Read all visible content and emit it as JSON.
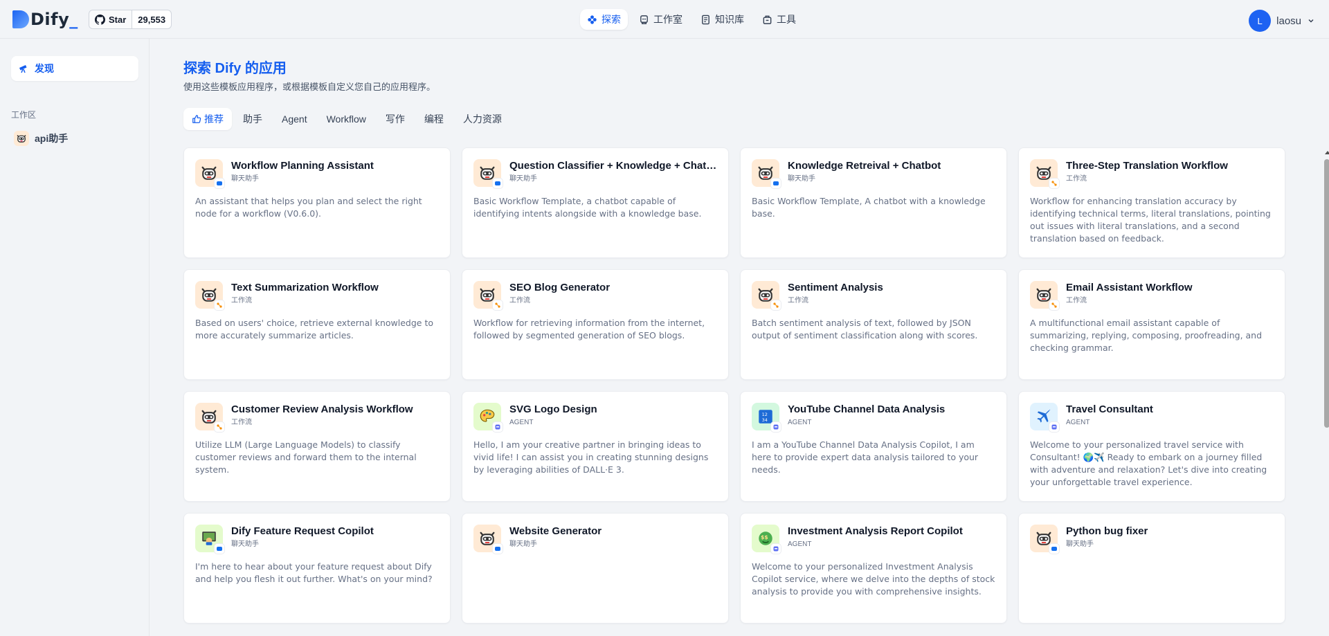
{
  "header": {
    "logo_text": "Dify",
    "logo_cursor": "_",
    "github": {
      "star_label": "Star",
      "count": "29,553"
    },
    "nav": [
      {
        "label": "探索",
        "icon": "explore-icon",
        "active": true
      },
      {
        "label": "工作室",
        "icon": "studio-icon",
        "active": false
      },
      {
        "label": "知识库",
        "icon": "knowledge-icon",
        "active": false
      },
      {
        "label": "工具",
        "icon": "tools-icon",
        "active": false
      }
    ],
    "user": {
      "initial": "L",
      "name": "laosu"
    }
  },
  "sidebar": {
    "discover_label": "发现",
    "workspace_title": "工作区",
    "apps": [
      {
        "name": "api助手",
        "icon": "robot-icon"
      }
    ]
  },
  "main": {
    "title": "探索 Dify 的应用",
    "subtitle": "使用这些模板应用程序，或根据模板自定义您自己的应用程序。",
    "categories": [
      {
        "label": "推荐",
        "active": true,
        "icon": "thumbs-up-icon"
      },
      {
        "label": "助手",
        "active": false
      },
      {
        "label": "Agent",
        "active": false
      },
      {
        "label": "Workflow",
        "active": false
      },
      {
        "label": "写作",
        "active": false
      },
      {
        "label": "编程",
        "active": false
      },
      {
        "label": "人力资源",
        "active": false
      }
    ],
    "apps": [
      {
        "name": "Workflow Planning Assistant",
        "type": "聊天助手",
        "icon": "robot-icon",
        "icon_bg": "#ffead5",
        "badge": "chat",
        "desc": "An assistant that helps you plan and select the right node for a workflow (V0.6.0)."
      },
      {
        "name": "Question Classifier + Knowledge + Chatbot",
        "type": "聊天助手",
        "icon": "robot-icon",
        "icon_bg": "#ffead5",
        "badge": "chat",
        "desc": "Basic Workflow Template, a chatbot capable of identifying intents alongside with a knowledge base."
      },
      {
        "name": "Knowledge Retreival + Chatbot",
        "type": "聊天助手",
        "icon": "robot-icon",
        "icon_bg": "#ffead5",
        "badge": "chat",
        "desc": "Basic Workflow Template, A chatbot with a knowledge base."
      },
      {
        "name": "Three-Step Translation Workflow",
        "type": "工作流",
        "icon": "robot-icon",
        "icon_bg": "#ffead5",
        "badge": "workflow",
        "desc": "Workflow for enhancing translation accuracy by identifying technical terms, literal translations, pointing out issues with literal translations, and a second translation based on feedback."
      },
      {
        "name": "Text Summarization Workflow",
        "type": "工作流",
        "icon": "robot-icon",
        "icon_bg": "#ffead5",
        "badge": "workflow",
        "desc": "Based on users' choice, retrieve external knowledge to more accurately summarize articles."
      },
      {
        "name": "SEO Blog Generator",
        "type": "工作流",
        "icon": "robot-icon",
        "icon_bg": "#ffead5",
        "badge": "workflow",
        "desc": "Workflow for retrieving information from the internet, followed by segmented generation of SEO blogs."
      },
      {
        "name": "Sentiment Analysis",
        "type": "工作流",
        "icon": "robot-icon",
        "icon_bg": "#ffead5",
        "badge": "workflow",
        "desc": "Batch sentiment analysis of text, followed by JSON output of sentiment classification along with scores."
      },
      {
        "name": "Email Assistant Workflow",
        "type": "工作流",
        "icon": "robot-icon",
        "icon_bg": "#ffead5",
        "badge": "workflow",
        "desc": "A multifunctional email assistant capable of summarizing, replying, composing, proofreading, and checking grammar."
      },
      {
        "name": "Customer Review Analysis Workflow",
        "type": "工作流",
        "icon": "robot-icon",
        "icon_bg": "#ffead5",
        "badge": "workflow",
        "desc": "Utilize LLM (Large Language Models) to classify customer reviews and forward them to the internal system."
      },
      {
        "name": "SVG Logo Design",
        "type": "AGENT",
        "icon": "palette-icon",
        "icon_bg": "#e4fbcc",
        "badge": "agent",
        "desc": "Hello, I am your creative partner in bringing ideas to vivid life! I can assist you in creating stunning designs by leveraging abilities of DALL·E 3."
      },
      {
        "name": "YouTube Channel Data Analysis",
        "type": "AGENT",
        "icon": "numbers-icon",
        "icon_bg": "#d3f8df",
        "badge": "agent",
        "desc": "I am a YouTube Channel Data Analysis Copilot, I am here to provide expert data analysis tailored to your needs."
      },
      {
        "name": "Travel Consultant",
        "type": "AGENT",
        "icon": "airplane-icon",
        "icon_bg": "#e0f2fe",
        "badge": "agent",
        "desc": "Welcome to your personalized travel service with Consultant! 🌍✈️ Ready to embark on a journey filled with adventure and relaxation? Let's dive into creating your unforgettable travel experience."
      },
      {
        "name": "Dify Feature Request Copilot",
        "type": "聊天助手",
        "icon": "teacher-icon",
        "icon_bg": "#e4fbcc",
        "badge": "chat",
        "desc": "I'm here to hear about your feature request about Dify and help you flesh it out further. What's on your mind?"
      },
      {
        "name": "Website Generator",
        "type": "聊天助手",
        "icon": "robot-icon",
        "icon_bg": "#ffead5",
        "badge": "chat",
        "desc": ""
      },
      {
        "name": "Investment Analysis Report Copilot",
        "type": "AGENT",
        "icon": "money-face-icon",
        "icon_bg": "#e4fbcc",
        "badge": "agent",
        "desc": "Welcome to your personalized Investment Analysis Copilot service, where we delve into the depths of stock analysis to provide you with comprehensive insights."
      },
      {
        "name": "Python bug fixer",
        "type": "聊天助手",
        "icon": "robot-icon",
        "icon_bg": "#ffead5",
        "badge": "chat",
        "desc": ""
      }
    ]
  },
  "colors": {
    "accent": "#155eef",
    "chat_badge": "#1570ef",
    "workflow_badge": "#f79009",
    "agent_badge": "#6172f3"
  }
}
